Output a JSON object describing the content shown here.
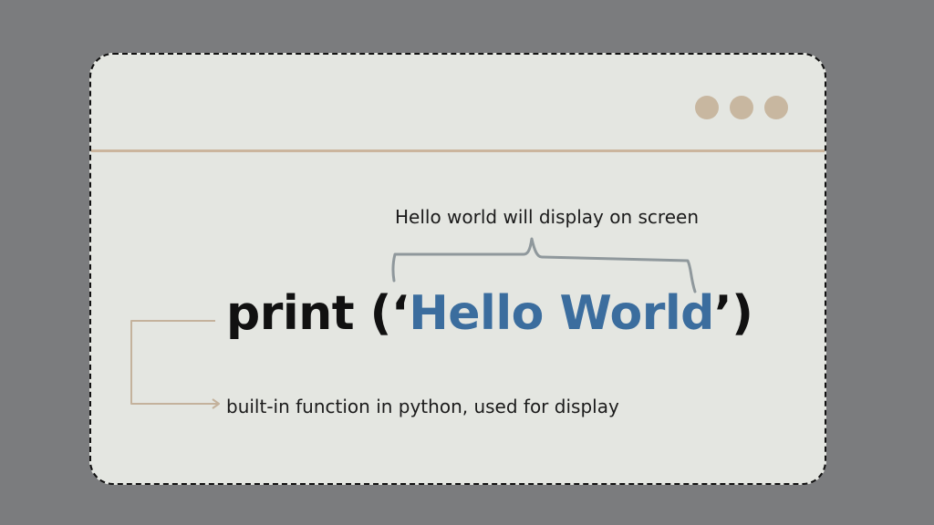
{
  "window": {
    "dot_count": 3,
    "accent_color": "#c8b7a0"
  },
  "code": {
    "function": "print",
    "open": " (‘",
    "argument": "Hello World",
    "close": "’)",
    "string_color": "#3b6d9e"
  },
  "annotations": {
    "top": "Hello world will display on screen",
    "bottom": "built-in function in python, used for display"
  },
  "colors": {
    "background": "#7b7c7e",
    "card": "#e4e6e1",
    "brace": "#8f989c",
    "arrow": "#c4b29c"
  }
}
